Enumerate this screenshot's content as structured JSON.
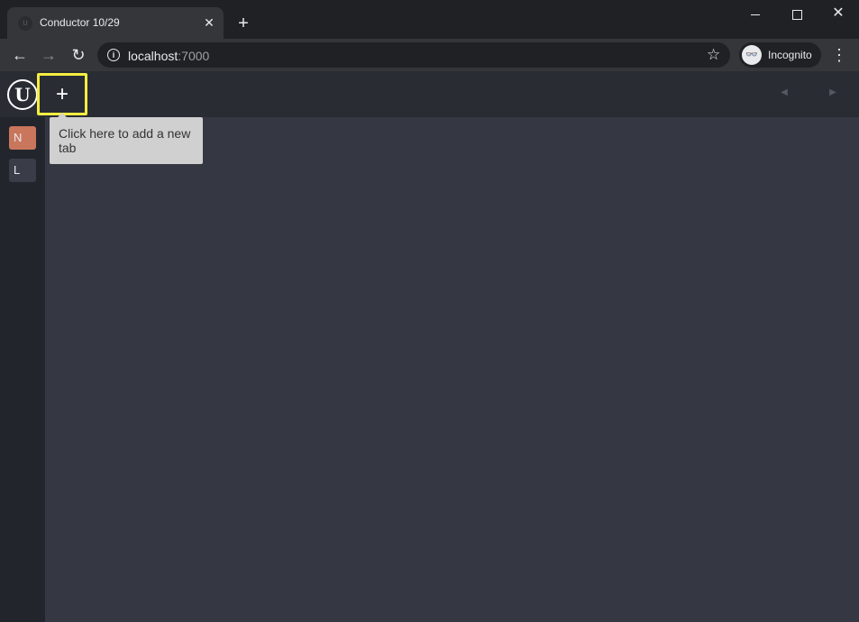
{
  "browser": {
    "tab_title": "Conductor 10/29",
    "tab_close": "✕",
    "new_tab": "+",
    "url_host": "localhost",
    "url_port": ":7000",
    "profile_label": "Incognito"
  },
  "app": {
    "logo": "U",
    "add_tab_symbol": "+",
    "sidebar": {
      "items": [
        {
          "label": "N",
          "color": "#c9765d"
        },
        {
          "label": "L",
          "color": "#3a3d48"
        }
      ]
    },
    "tooltip": "Click here to add a new tab"
  },
  "colors": {
    "highlight": "#f4ee41",
    "app_background": "#353843"
  }
}
